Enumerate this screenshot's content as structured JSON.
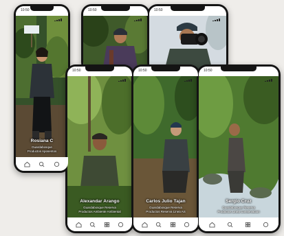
{
  "status_time": "10:50",
  "phones": [
    {
      "id": "phone1",
      "name": "Rosiana C",
      "role_lines": [
        "Guardabosque",
        "Productos Aposentos"
      ]
    },
    {
      "id": "phone2",
      "name": "",
      "role_lines": []
    },
    {
      "id": "phone3",
      "name": "",
      "role_lines": []
    },
    {
      "id": "phone4",
      "name": "Alexandar Arango",
      "role_lines": [
        "Guardabosque Reserva",
        "Productos Ambiente Ambiental"
      ]
    },
    {
      "id": "phone5",
      "name": "Carlos Julio Tajan",
      "role_lines": [
        "Guardabosque Reserva",
        "Productos Reserva Linea AS"
      ]
    },
    {
      "id": "phone6",
      "name": "Sergio Cruz",
      "role_lines": [
        "Guardabosque Reserva",
        "Productos Linea Conservacion"
      ]
    }
  ],
  "sign_text": "",
  "nav_icons": [
    "home-icon",
    "search-icon",
    "grid-icon",
    "profile-icon"
  ],
  "colors": {
    "phone_frame": "#141414",
    "background": "#efedea",
    "forest_dark": "#2f4a1f",
    "forest_light": "#7fa14a"
  }
}
